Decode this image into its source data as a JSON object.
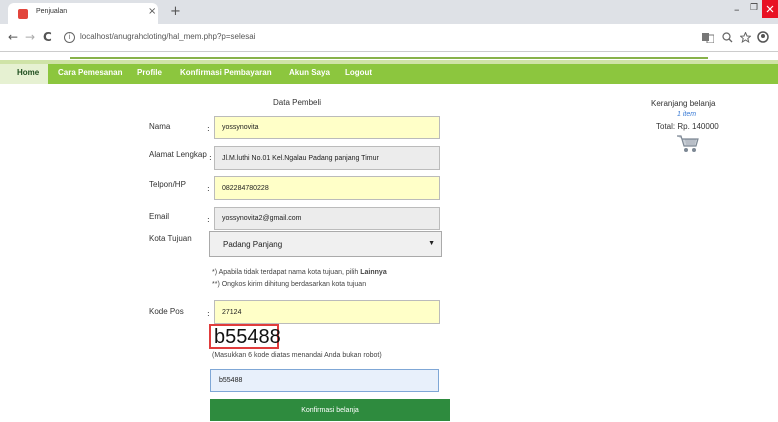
{
  "browser": {
    "tab_title": "Penjualan",
    "tab_close": "×",
    "new_tab": "+",
    "url": "localhost/anugrahcloting/hal_mem.php?p=selesai",
    "back": "←",
    "forward": "→",
    "reload": "C",
    "win_min": "–",
    "win_max": "❐"
  },
  "nav": {
    "items": [
      "Home",
      "Cara Pemesanan",
      "Profile",
      "Konfirmasi Pembayaran",
      "Akun Saya",
      "Logout"
    ]
  },
  "form": {
    "title": "Data Pembeli",
    "colon": ":",
    "nama_label": "Nama",
    "nama_value": "yossynovita",
    "alamat_label": "Alamat Lengkap",
    "alamat_value": "Jl.M.luthi No.01 Kel.Ngalau Padang panjang Timur",
    "telpon_label": "Telpon/HP",
    "telpon_value": "082284780228",
    "email_label": "Email",
    "email_value": "yossynovita2@gmail.com",
    "kota_label": "Kota Tujuan",
    "kota_value": "Padang Panjang",
    "note1_prefix": "*) Apabila tidak terdapat nama kota tujuan, pilih ",
    "note1_bold": "Lainnya",
    "note2": "**) Ongkos kirim dihitung berdasarkan kota tujuan",
    "kodepos_label": "Kode Pos",
    "kodepos_value": "27124",
    "captcha": "b55488",
    "captcha_hint": "(Masukkan 6 kode diatas menandai Anda bukan robot)",
    "captcha_input": "b55488",
    "submit": "Konfirmasi belanja"
  },
  "cart": {
    "title": "Keranjang belanja",
    "items": "1 item",
    "total": "Total: Rp. 140000"
  }
}
